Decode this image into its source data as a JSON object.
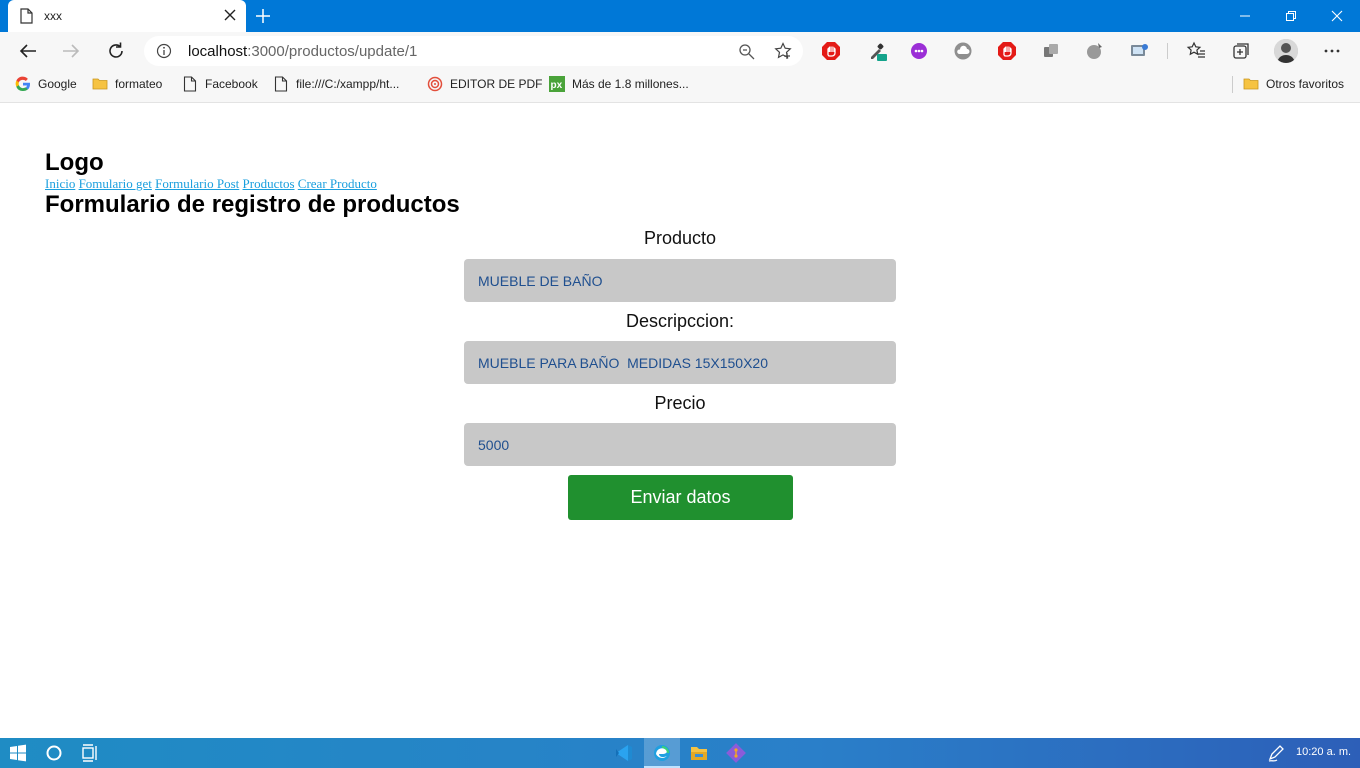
{
  "browser": {
    "tab_title": "xxx",
    "url_host": "localhost",
    "url_path": ":3000/productos/update/1"
  },
  "bookmarks": [
    {
      "label": "Google",
      "icon": "google-icon"
    },
    {
      "label": "formateo",
      "icon": "folder-icon"
    },
    {
      "label": "Facebook",
      "icon": "page-icon"
    },
    {
      "label": "file:///C:/xampp/ht...",
      "icon": "page-icon"
    },
    {
      "label": "EDITOR DE PDF",
      "icon": "pdf-editor-icon"
    },
    {
      "label": "Más de 1.8 millones...",
      "icon": "px-icon"
    }
  ],
  "other_favorites": "Otros favoritos",
  "page": {
    "logo": "Logo",
    "nav": [
      "Inicio",
      "Fomulario get",
      "Formulario Post",
      "Productos",
      "Crear Producto"
    ],
    "title": "Formulario de registro de productos",
    "form": {
      "producto_label": "Producto",
      "producto_value": "MUEBLE DE BAÑO",
      "descripcion_label": "Descripccion:",
      "descripcion_value": "MUEBLE PARA BAÑO  MEDIDAS 15X150X20",
      "precio_label": "Precio",
      "precio_value": "5000",
      "submit_label": "Enviar datos"
    }
  },
  "taskbar": {
    "clock": "10:20 a. m."
  },
  "colors": {
    "titlebar": "#0078d7",
    "link": "#1a9fde",
    "input_bg": "#c8c8c8",
    "input_text": "#1f4f8f",
    "submit_bg": "#20902f"
  }
}
